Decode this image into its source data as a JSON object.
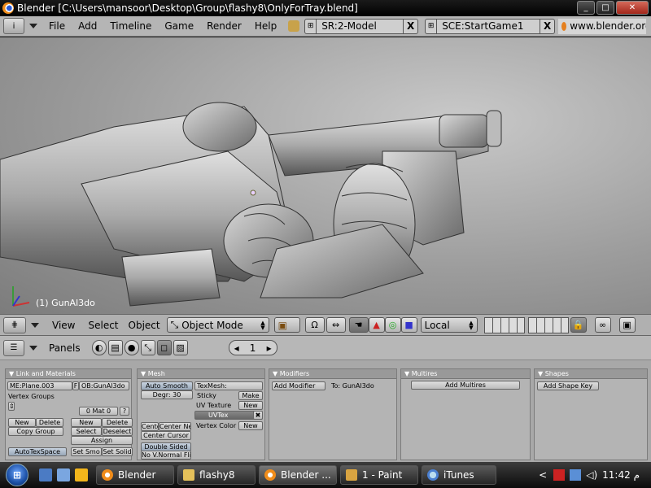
{
  "window": {
    "title": "Blender [C:\\Users\\mansoor\\Desktop\\Group\\flashy8\\OnlyForTray.blend]",
    "buttons": {
      "minimize": "_",
      "maximize": "□",
      "close": "✕"
    }
  },
  "info_header": {
    "icon": "i",
    "menus": [
      "File",
      "Add",
      "Timeline",
      "Game",
      "Render",
      "Help"
    ],
    "screen": {
      "prefix": "⊞",
      "value": "SR:2-Model",
      "close": "X"
    },
    "scene": {
      "value": "SCE:StartGame1",
      "close": "X"
    },
    "url": "www.blender.org"
  },
  "viewport": {
    "object_label": "(1) GunAl3do"
  },
  "view3d_header": {
    "menus": [
      "View",
      "Select",
      "Object"
    ],
    "mode": "Object Mode",
    "orientation": "Local"
  },
  "buttons_header": {
    "panels_label": "Panels",
    "frame": "1",
    "arrow_left": "◂",
    "arrow_right": "▸"
  },
  "panels": {
    "link": {
      "title": "Link and Materials",
      "mesh_name": "ME:Plane.003",
      "f_label": "F",
      "object_name": "OB:GunAl3do",
      "vertex_groups": "Vertex Groups",
      "mat_count": "0 Mat 0",
      "question": "?",
      "new1": "New",
      "delete1": "Delete",
      "copy_group": "Copy Group",
      "new2": "New",
      "delete2": "Delete",
      "select": "Select",
      "deselect": "Deselect",
      "assign": "Assign",
      "autotex": "AutoTexSpace",
      "set_smo": "Set Smo",
      "set_solid": "Set Solid"
    },
    "mesh": {
      "title": "Mesh",
      "auto_smooth": "Auto Smooth",
      "degr": "Degr: 30",
      "center": "Cente",
      "center_new": "Center Ne",
      "center_cursor": "Center Cursor",
      "double_sided": "Double Sided",
      "no_vnormal": "No V.Normal Fli",
      "texmesh": "TexMesh:",
      "sticky": "Sticky",
      "make": "Make",
      "uv_texture": "UV Texture",
      "new_uv": "New",
      "uvtex": "UVTex",
      "uvtex_x": "✖",
      "vertex_color": "Vertex Color",
      "new_vc": "New"
    },
    "modifiers": {
      "title": "Modifiers",
      "add_modifier": "Add Modifier",
      "to": "To: GunAl3do"
    },
    "multires": {
      "title": "Multires",
      "add": "Add Multires"
    },
    "shapes": {
      "title": "Shapes",
      "add": "Add Shape Key"
    }
  },
  "taskbar": {
    "start": "⊞",
    "tasks": [
      "Blender",
      "flashy8",
      "Blender ...",
      "1 - Paint",
      "iTunes"
    ],
    "tray_arrow": "<",
    "clock": "11:42 م"
  }
}
